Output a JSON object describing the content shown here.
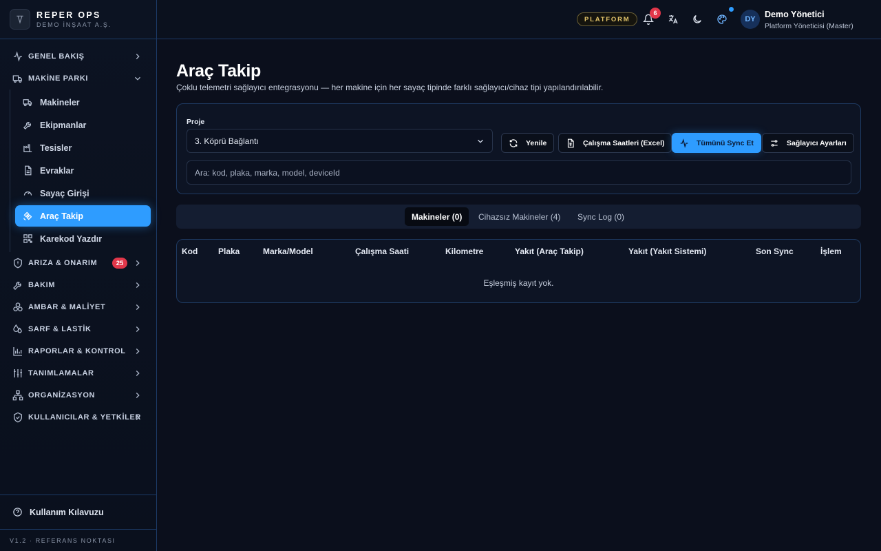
{
  "brand": {
    "title": "REPER OPS",
    "subtitle": "DEMO İNŞAAT A.Ş."
  },
  "sidebar": {
    "items": [
      {
        "label": "GENEL BAKIŞ",
        "icon": "activity-icon"
      },
      {
        "label": "MAKİNE PARKI",
        "icon": "truck-icon",
        "expanded": true
      },
      {
        "label": "ARIZA & ONARIM",
        "icon": "shield-alert-icon",
        "badge": "25"
      },
      {
        "label": "BAKIM",
        "icon": "wrench-icon"
      },
      {
        "label": "AMBAR & MALİYET",
        "icon": "boxes-icon"
      },
      {
        "label": "SARF & LASTİK",
        "icon": "droplets-icon"
      },
      {
        "label": "RAPORLAR & KONTROL",
        "icon": "bar-chart-icon"
      },
      {
        "label": "TANIMLAMALAR",
        "icon": "sliders-icon"
      },
      {
        "label": "ORGANİZASYON",
        "icon": "network-icon"
      },
      {
        "label": "KULLANICILAR & YETKİLER",
        "icon": "shield-check-icon"
      }
    ],
    "subitems": [
      {
        "label": "Makineler",
        "icon": "truck-icon"
      },
      {
        "label": "Ekipmanlar",
        "icon": "wrench-icon"
      },
      {
        "label": "Tesisler",
        "icon": "factory-icon"
      },
      {
        "label": "Evraklar",
        "icon": "file-icon"
      },
      {
        "label": "Sayaç Girişi",
        "icon": "gauge-icon"
      },
      {
        "label": "Araç Takip",
        "icon": "satellite-icon",
        "active": true
      },
      {
        "label": "Karekod Yazdır",
        "icon": "qr-code-icon"
      }
    ],
    "help_label": "Kullanım Kılavuzu",
    "version": "V1.2 · REFERANS NOKTASI"
  },
  "header": {
    "platform_label": "PLATFORM",
    "notification_count": "6",
    "avatar_initials": "DY",
    "user_name": "Demo Yönetici",
    "user_role": "Platform Yöneticisi (Master)"
  },
  "page": {
    "title": "Araç Takip",
    "description": "Çoklu telemetri sağlayıcı entegrasyonu — her makine için her sayaç tipinde farklı sağlayıcı/cihaz tipi yapılandırılabilir."
  },
  "filters": {
    "project_label": "Proje",
    "project_value": "3. Köprü Bağlantı",
    "search_placeholder": "Ara: kod, plaka, marka, model, deviceId",
    "buttons": {
      "refresh": "Yenile",
      "work_hours": "Çalışma Saatleri (Excel)",
      "sync_all": "Tümünü Sync Et",
      "provider_settings": "Sağlayıcı Ayarları"
    }
  },
  "tabs": [
    {
      "label": "Makineler (0)",
      "active": true
    },
    {
      "label": "Cihazsız Makineler (4)",
      "active": false
    },
    {
      "label": "Sync Log (0)",
      "active": false
    }
  ],
  "table": {
    "columns": [
      "Kod",
      "Plaka",
      "Marka/Model",
      "Çalışma Saati",
      "Kilometre",
      "Yakıt (Araç Takip)",
      "Yakıt (Yakıt Sistemi)",
      "Son Sync",
      "İşlem"
    ],
    "empty_text": "Eşleşmiş kayıt yok."
  },
  "colors": {
    "accent": "#2e9cff",
    "badge": "#e2374a",
    "platform": "#e2c46b",
    "background": "#0b0f1c"
  }
}
